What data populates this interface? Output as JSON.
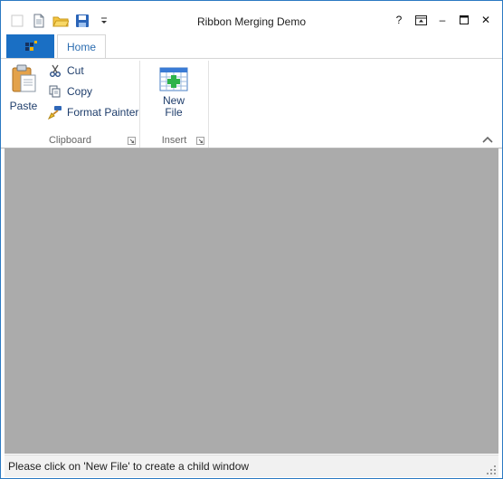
{
  "window": {
    "title": "Ribbon Merging Demo"
  },
  "qat": {
    "items": [
      "app-icon",
      "new-document-icon",
      "open-folder-icon",
      "save-disk-icon",
      "customize-dropdown-icon"
    ]
  },
  "window_buttons": {
    "help": "?",
    "minimize": "–",
    "close": "✕"
  },
  "tabs": [
    {
      "label": "Home",
      "active": true
    }
  ],
  "groups": {
    "clipboard": {
      "label": "Clipboard",
      "paste": "Paste",
      "cut": "Cut",
      "copy": "Copy",
      "format_painter": "Format Painter"
    },
    "insert": {
      "label": "Insert",
      "new_file_line1": "New",
      "new_file_line2": "File"
    }
  },
  "status": {
    "text": "Please click on 'New File' to create a child window"
  },
  "colors": {
    "accent": "#1a6fc4",
    "client_bg": "#ababab",
    "tab_text": "#2b6cb0"
  }
}
